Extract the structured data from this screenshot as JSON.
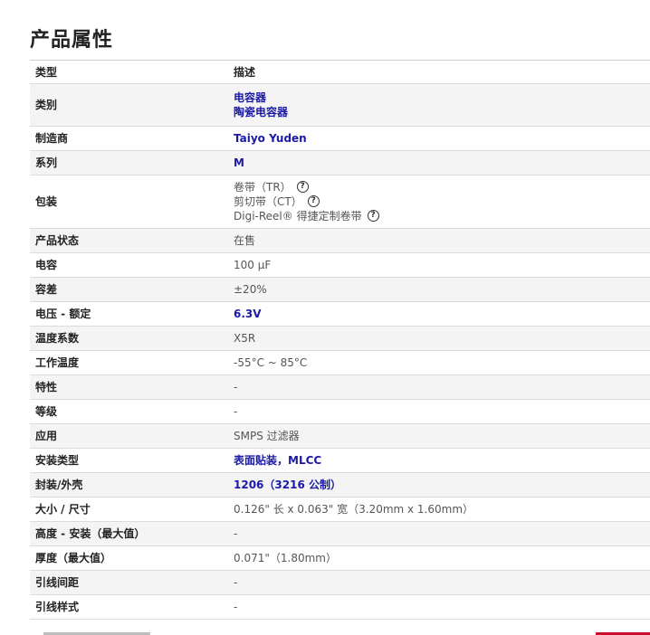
{
  "title": "产品属性",
  "header": {
    "type": "类型",
    "desc": "描述"
  },
  "rows": [
    {
      "label": "类别",
      "lines": [
        "电容器",
        "陶瓷电容器"
      ],
      "style": "link"
    },
    {
      "label": "制造商",
      "value": "Taiyo Yuden",
      "style": "link"
    },
    {
      "label": "系列",
      "value": "M",
      "style": "link"
    },
    {
      "label": "包装",
      "lines": [
        "卷带（TR）",
        "剪切带（CT）",
        "Digi-Reel® 得捷定制卷带"
      ],
      "style": "plain",
      "help_icon": "question-circle-icon"
    },
    {
      "label": "产品状态",
      "value": "在售",
      "style": "plain"
    },
    {
      "label": "电容",
      "value": "100 µF",
      "style": "plain"
    },
    {
      "label": "容差",
      "value": "±20%",
      "style": "plain"
    },
    {
      "label": "电压 - 额定",
      "value": "6.3V",
      "style": "link"
    },
    {
      "label": "温度系数",
      "value": "X5R",
      "style": "plain"
    },
    {
      "label": "工作温度",
      "value": "-55°C ~ 85°C",
      "style": "plain"
    },
    {
      "label": "特性",
      "value": "-",
      "style": "plain"
    },
    {
      "label": "等级",
      "value": "-",
      "style": "plain"
    },
    {
      "label": "应用",
      "value": "SMPS 过滤器",
      "style": "plain"
    },
    {
      "label": "安装类型",
      "value": "表面贴装，MLCC",
      "style": "link"
    },
    {
      "label": "封装/外壳",
      "value": "1206（3216 公制）",
      "style": "link"
    },
    {
      "label": "大小 / 尺寸",
      "value": "0.126\" 长 x 0.063\" 宽（3.20mm x 1.60mm）",
      "style": "plain"
    },
    {
      "label": "高度 - 安装（最大值）",
      "value": "-",
      "style": "plain"
    },
    {
      "label": "厚度（最大值）",
      "value": "0.071\"（1.80mm）",
      "style": "plain"
    },
    {
      "label": "引线间距",
      "value": "-",
      "style": "plain"
    },
    {
      "label": "引线样式",
      "value": "-",
      "style": "plain"
    }
  ],
  "colors": {
    "link": "#1a1aa6",
    "text": "#555555",
    "stripe": "#f4f4f4",
    "accent": "#c8102e"
  }
}
